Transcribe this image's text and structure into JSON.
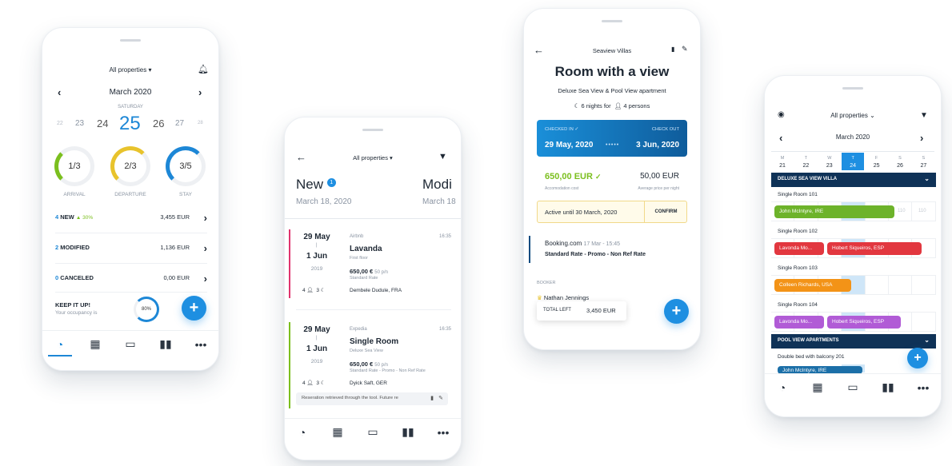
{
  "phone1": {
    "filter": "All properties",
    "month": "March 2020",
    "weekday": "SATURDAY",
    "days": [
      "22",
      "23",
      "24",
      "25",
      "26",
      "27",
      "28"
    ],
    "rings": [
      {
        "value": "1/3",
        "label": "ARRIVAL",
        "color": "#7bbf1e",
        "fraction": 0.33
      },
      {
        "value": "2/3",
        "label": "DEPARTURE",
        "color": "#e8c32c",
        "fraction": 0.66
      },
      {
        "value": "3/5",
        "label": "STAY",
        "color": "#1d87d6",
        "fraction": 0.6
      }
    ],
    "stats": [
      {
        "count": "4",
        "label": "NEW",
        "delta": "▲ 30%",
        "amount": "3,455 EUR",
        "color": "#1d87d6"
      },
      {
        "count": "2",
        "label": "MODIFIED",
        "delta": "",
        "amount": "1,136 EUR",
        "color": "#1d87d6"
      },
      {
        "count": "0",
        "label": "CANCELED",
        "delta": "",
        "amount": "0,00 EUR",
        "color": "#1d87d6"
      }
    ],
    "keep_title": "KEEP IT UP!",
    "keep_sub": "Your occupancy is",
    "occupancy": "80%",
    "occupancy_fraction": 0.8
  },
  "phone2": {
    "filter": "All properties",
    "tab1": "New",
    "tab1_badge": "1",
    "tab1_date": "March 18, 2020",
    "tab2": "Modi",
    "tab2_date": "March 18",
    "bookings": [
      {
        "from": "29 May",
        "to": "1 Jun",
        "year": "2019",
        "source": "Airbnb",
        "time": "16:35",
        "title": "Lavanda",
        "subtitle": "First floor",
        "price": "650,00 €",
        "per": "50 p/n",
        "rate": "Standard Rate",
        "guests": "4",
        "nights": "3",
        "guest": "Dembele Dudule, FRA",
        "accent": "#e0336e"
      },
      {
        "from": "29 May",
        "to": "1 Jun",
        "year": "2019",
        "source": "Expedia",
        "time": "16:35",
        "title": "Single Room",
        "subtitle": "Deluxe Sea View",
        "price": "650,00 €",
        "per": "50 p/n",
        "rate": "Standard Rate - Promo - Non Ref Rate",
        "guests": "4",
        "nights": "3",
        "guest": "Dyick Saft, GER",
        "accent": "#7bbf1e"
      }
    ],
    "note": "Reseration retrieved through the tool. Future re"
  },
  "phone3": {
    "header": "Seaview Villas",
    "title": "Room with a view",
    "subtitle": "Deluxe Sea View & Pool View apartment",
    "nights": "6 nights for",
    "persons": "4 persons",
    "checkin_label": "CHECKED IN ✓",
    "checkin_date": "29 May, 2020",
    "checkout_label": "CHECK OUT",
    "checkout_date": "3 Jun, 2020",
    "cost": "650,00 EUR",
    "cost_label": "Accomodation cost",
    "avg": "50,00 EUR",
    "avg_label": "Average price per night",
    "active": "Active until  30 March, 2020",
    "confirm": "CONFIRM",
    "channel": "Booking.com",
    "channel_date": "17 Mar - 15:45",
    "rate": "Standard Rate - Promo - Non Ref Rate",
    "booker_label": "BOOKER",
    "booker": "Nathan Jennings",
    "total_label": "TOTAL LEFT",
    "total": "3,450 EUR"
  },
  "phone4": {
    "filter": "All properties",
    "month": "March 2020",
    "days": [
      {
        "w": "M",
        "d": "21"
      },
      {
        "w": "T",
        "d": "22"
      },
      {
        "w": "W",
        "d": "23"
      },
      {
        "w": "T",
        "d": "24"
      },
      {
        "w": "F",
        "d": "25"
      },
      {
        "w": "S",
        "d": "26"
      },
      {
        "w": "S",
        "d": "27"
      }
    ],
    "section1": "DELUXE SEA VIEW VILLA",
    "rooms": [
      "Single Room 101",
      "Single Room 102",
      "Single Room 103",
      "Single Room 104"
    ],
    "bars": [
      {
        "label": "John McIntyre, IRE",
        "color": "#6db32a"
      },
      {
        "label": "Lavonda Mo...",
        "color": "#e2373f"
      },
      {
        "label": "Hobert Siqueiros, ESP",
        "color": "#e2373f"
      },
      {
        "label": "Colleen Richards, USA",
        "color": "#f39317"
      },
      {
        "label": "Lavonda Mo...",
        "color": "#b15bd6"
      },
      {
        "label": "Hobert Siqueiros, ESP",
        "color": "#b15bd6"
      },
      {
        "label": "John McIntyre, IRE",
        "color": "#1b6fa8"
      }
    ],
    "dim": [
      "110",
      "110"
    ],
    "section2": "POOL VIEW APARTMENTS",
    "room5": "Double bed with balcony 201"
  }
}
